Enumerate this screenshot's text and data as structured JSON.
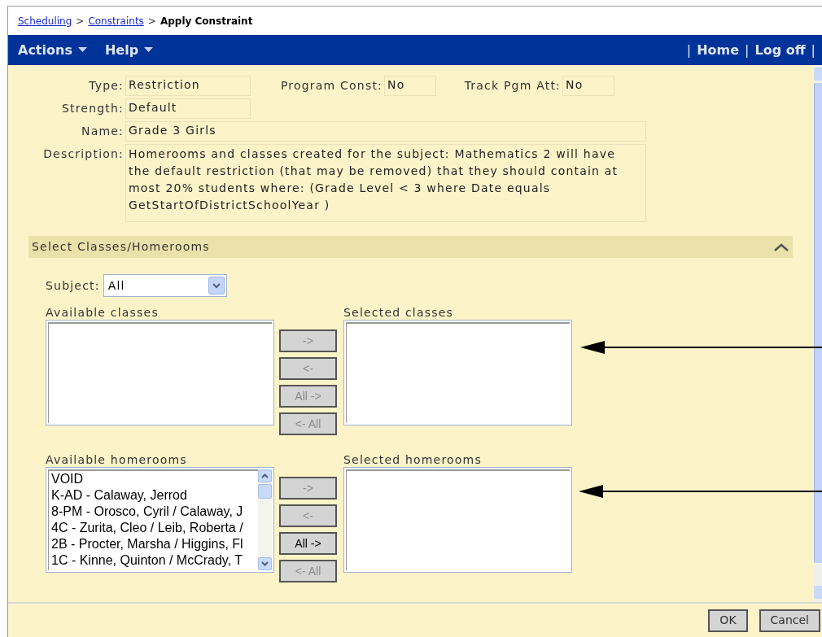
{
  "breadcrumb": [
    {
      "label": "Scheduling",
      "kind": "link"
    },
    {
      "label": ">",
      "kind": "separator"
    },
    {
      "label": "Constraints",
      "kind": "link"
    },
    {
      "label": ">",
      "kind": "separator"
    },
    {
      "label": "Apply Constraint",
      "kind": "current"
    }
  ],
  "menus": [
    {
      "label": "Actions"
    },
    {
      "label": "Help"
    }
  ],
  "nav_links": [
    {
      "label": "|",
      "kind": "separator"
    },
    {
      "label": "Home",
      "kind": "link"
    },
    {
      "label": "|",
      "kind": "separator"
    },
    {
      "label": "Log off",
      "kind": "link"
    },
    {
      "label": "|",
      "kind": "separator"
    }
  ],
  "fields": {
    "type": {
      "label": "Type:",
      "value": "Restriction"
    },
    "program_const": {
      "label": "Program Const:",
      "value": "No"
    },
    "track_pgm_att": {
      "label": "Track Pgm Att:",
      "value": "No"
    },
    "strength": {
      "label": "Strength:",
      "value": "Default"
    },
    "name": {
      "label": "Name:",
      "value": "Grade 3 Girls"
    },
    "description": {
      "label": "Description:",
      "value": "Homerooms and classes created for the subject: Mathematics 2 will have the default restriction (that may be removed) that they should contain at most 20% students where: (Grade Level < 3 where Date equals GetStartOfDistrictSchoolYear )"
    }
  },
  "section": {
    "title": "Select Classes/Homerooms",
    "expanded": true
  },
  "subject": {
    "label": "Subject:",
    "value": "All"
  },
  "pickers": [
    {
      "available_label": "Available classes",
      "selected_label": "Selected classes",
      "buttons": [
        {
          "label": "->",
          "disabled": true
        },
        {
          "label": "<-",
          "disabled": true
        },
        {
          "label": "All ->",
          "disabled": true
        },
        {
          "label": "<- All",
          "disabled": true
        }
      ]
    },
    {
      "available_label": "Available homerooms",
      "selected_label": "Selected homerooms",
      "available_items": [
        "VOID",
        "K-AD - Calaway, Jerrod",
        "8-PM - Orosco, Cyril / Calaway, J",
        "4C - Zurita, Cleo / Leib, Roberta /",
        "2B - Procter, Marsha / Higgins, Fl",
        "1C - Kinne, Quinton / McCrady, T"
      ],
      "buttons": [
        {
          "label": "->",
          "disabled": true
        },
        {
          "label": "<-",
          "disabled": true
        },
        {
          "label": "All ->",
          "disabled": false
        },
        {
          "label": "<- All",
          "disabled": true
        }
      ]
    }
  ],
  "footer_buttons": [
    "OK",
    "Cancel"
  ]
}
